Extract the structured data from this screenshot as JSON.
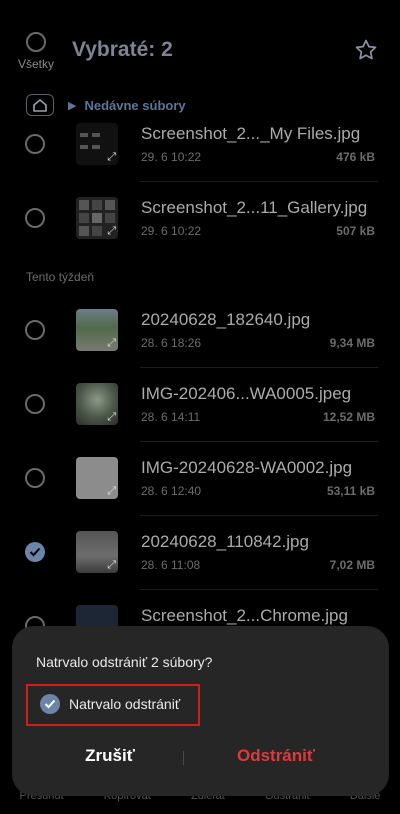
{
  "header": {
    "select_all_label": "Všetky",
    "title": "Vybraté: 2"
  },
  "breadcrumb": {
    "path": "Nedávne súbory"
  },
  "section_label": "Tento týždeň",
  "files_earlier": [
    {
      "name": "Screenshot_2..._My Files.jpg",
      "date": "29. 6 10:22",
      "size": "476 kB",
      "selected": false
    },
    {
      "name": "Screenshot_2...11_Gallery.jpg",
      "date": "29. 6 10:22",
      "size": "507 kB",
      "selected": false
    }
  ],
  "files_week": [
    {
      "name": "20240628_182640.jpg",
      "date": "28. 6 18:26",
      "size": "9,34 MB",
      "selected": false
    },
    {
      "name": "IMG-202406...WA0005.jpeg",
      "date": "28. 6 14:11",
      "size": "12,52 MB",
      "selected": false
    },
    {
      "name": "IMG-20240628-WA0002.jpg",
      "date": "28. 6 12:40",
      "size": "53,11 kB",
      "selected": false
    },
    {
      "name": "20240628_110842.jpg",
      "date": "28. 6 11:08",
      "size": "7,02 MB",
      "selected": true
    },
    {
      "name": "Screenshot_2...Chrome.jpg",
      "date": "",
      "size": "",
      "selected": false
    }
  ],
  "bottom_bar": [
    "Presunúť",
    "Kopírovať",
    "Zdieľať",
    "Odstrániť",
    "Ďalšie"
  ],
  "dialog": {
    "title": "Natrvalo odstrániť 2 súbory?",
    "checkbox_label": "Natrvalo odstrániť",
    "checkbox_checked": true,
    "cancel_label": "Zrušiť",
    "delete_label": "Odstrániť"
  },
  "colors": {
    "accent": "#6b84a8",
    "delete": "#e0393b",
    "highlight": "#d71a1a",
    "dialog_bg": "#262626"
  }
}
